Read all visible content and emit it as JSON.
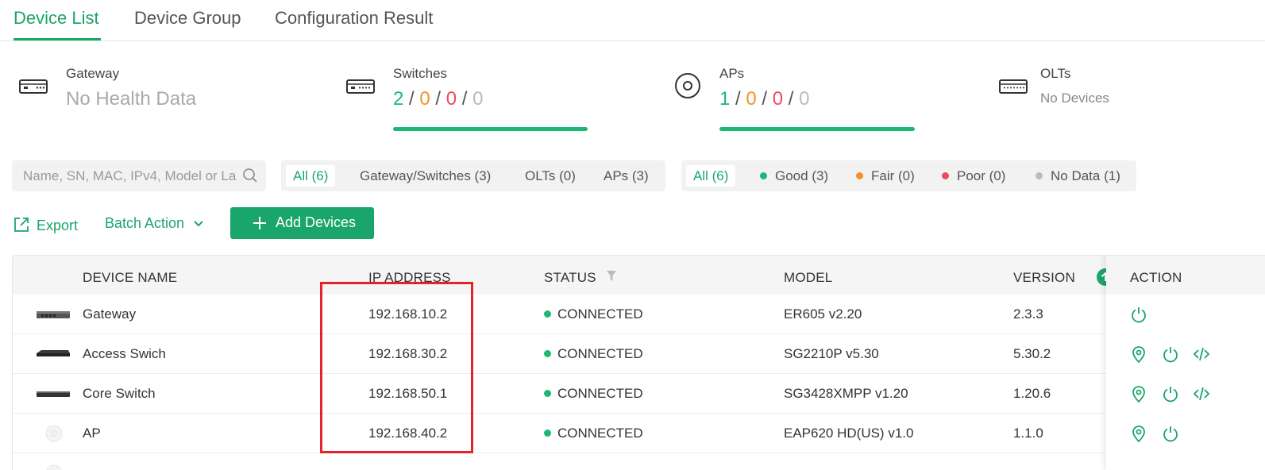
{
  "tabs": [
    "Device List",
    "Device Group",
    "Configuration Result"
  ],
  "stats": {
    "gateway": {
      "title": "Gateway",
      "value": "No Health Data"
    },
    "switches": {
      "title": "Switches",
      "v1": "2",
      "v2": "0",
      "v3": "0",
      "v4": "0",
      "sep": "/"
    },
    "aps": {
      "title": "APs",
      "v1": "1",
      "v2": "0",
      "v3": "0",
      "v4": "0",
      "sep": "/"
    },
    "olts": {
      "title": "OLTs",
      "value": "No Devices"
    }
  },
  "search": {
    "placeholder": "Name, SN, MAC, IPv4, Model or La..."
  },
  "type_filters": [
    "All (6)",
    "Gateway/Switches (3)",
    "OLTs (0)",
    "APs (3)"
  ],
  "health_filters": [
    "All (6)",
    "Good (3)",
    "Fair (0)",
    "Poor (0)",
    "No Data (1)"
  ],
  "actions": {
    "export": "Export",
    "batch": "Batch Action",
    "add": "Add Devices"
  },
  "table": {
    "headers": {
      "name": "DEVICE NAME",
      "ip": "IP ADDRESS",
      "status": "STATUS",
      "model": "MODEL",
      "version": "VERSION",
      "action": "ACTION"
    },
    "rows": [
      {
        "name": "Gateway",
        "ip": "192.168.10.2",
        "status": "CONNECTED",
        "model": "ER605 v2.20",
        "version": "2.3.3"
      },
      {
        "name": "Access Swich",
        "ip": "192.168.30.2",
        "status": "CONNECTED",
        "model": "SG2210P v5.30",
        "version": "5.30.2"
      },
      {
        "name": "Core Switch",
        "ip": "192.168.50.1",
        "status": "CONNECTED",
        "model": "SG3428XMPP v1.20",
        "version": "1.20.6"
      },
      {
        "name": "AP",
        "ip": "192.168.40.2",
        "status": "CONNECTED",
        "model": "EAP620 HD(US) v1.0",
        "version": "1.1.0"
      }
    ]
  },
  "colors": {
    "accent": "#1aa56a",
    "good": "#1ab872",
    "fair": "#f5902a",
    "poor": "#ee4a5f",
    "nodata": "#bbbbbb",
    "highlight": "#e5212b"
  }
}
